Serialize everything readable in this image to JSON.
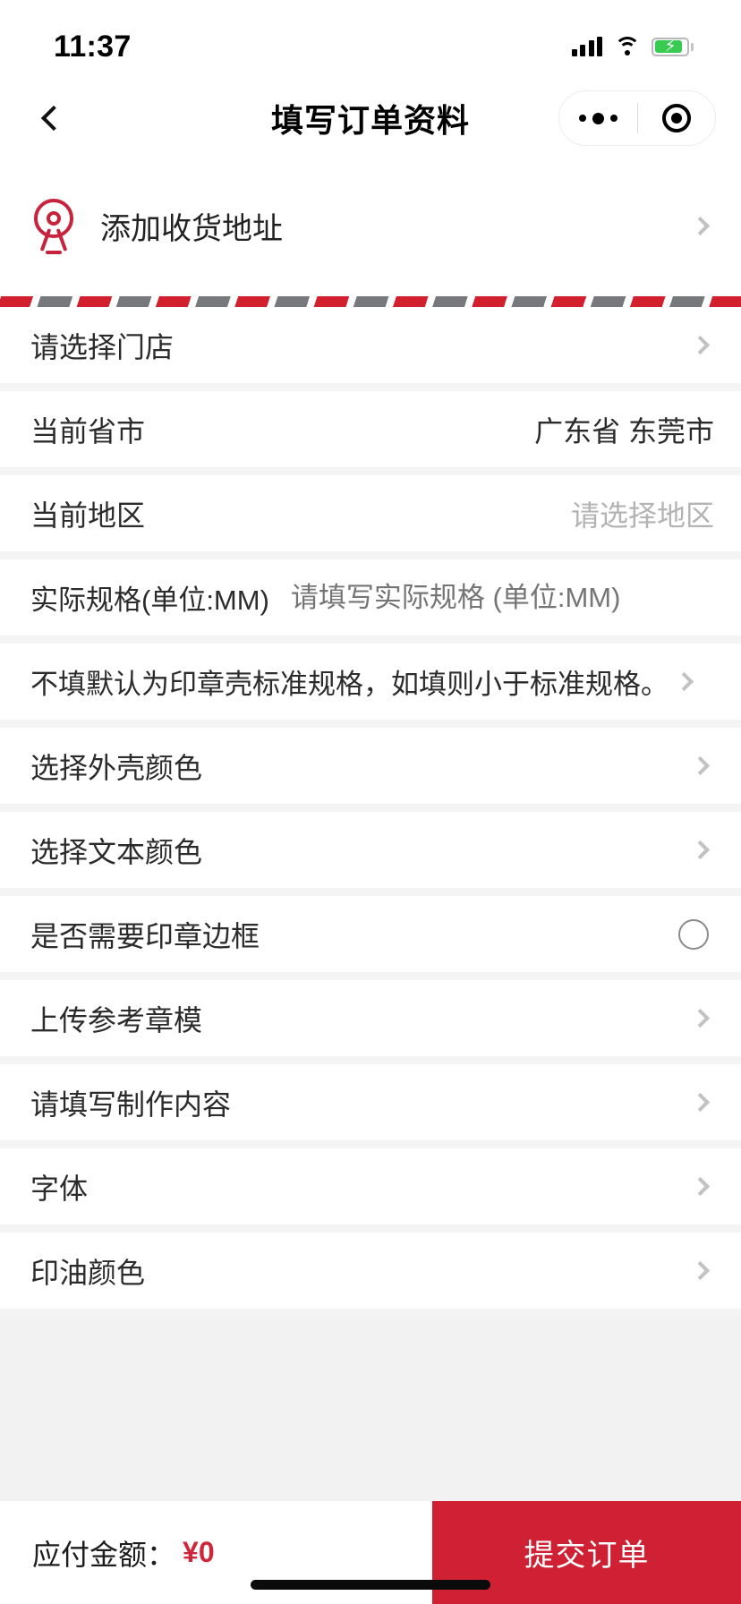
{
  "status_bar": {
    "time": "11:37",
    "signal_icon": "cellular-signal-icon",
    "wifi_icon": "wifi-icon",
    "battery_icon": "battery-charging-icon",
    "battery_bolt": "⚡"
  },
  "nav": {
    "back_icon": "back-chevron-icon",
    "title": "填写订单资料",
    "capsule": {
      "more_icon": "more-dots-icon",
      "target_icon": "target-circle-icon"
    }
  },
  "address": {
    "icon": "location-pin-icon",
    "label": "添加收货地址",
    "chevron": "chevron-right-icon"
  },
  "divider": {
    "style": "diagonal-stripes",
    "red": "#d2202e",
    "gray": "#77787b"
  },
  "rows": [
    {
      "label": "请选择门店",
      "value": "",
      "control": "chevron"
    },
    {
      "label": "当前省市",
      "value": "广东省 东莞市",
      "control": "value"
    },
    {
      "label": "当前地区",
      "value": "请选择地区",
      "control": "value"
    },
    {
      "label": "实际规格(单位:MM)",
      "placeholder": "请填写实际规格 (单位:MM)",
      "control": "input"
    },
    {
      "label": "不填默认为印章壳标准规格，如填则小于标准规格。",
      "value": "",
      "control": "chevron-tight"
    },
    {
      "label": "选择外壳颜色",
      "value": "",
      "control": "chevron"
    },
    {
      "label": "选择文本颜色",
      "value": "",
      "control": "chevron"
    },
    {
      "label": "是否需要印章边框",
      "value": "",
      "control": "radio"
    },
    {
      "label": "上传参考章模",
      "value": "",
      "control": "chevron"
    },
    {
      "label": "请填写制作内容",
      "value": "",
      "control": "chevron"
    },
    {
      "label": "字体",
      "value": "",
      "control": "chevron"
    },
    {
      "label": "印油颜色",
      "value": "",
      "control": "chevron"
    }
  ],
  "footer": {
    "pay_label": "应付金额：",
    "pay_amount": "¥0",
    "submit_label": "提交订单",
    "submit_color": "#cf2133",
    "amount_color": "#d0263a"
  }
}
